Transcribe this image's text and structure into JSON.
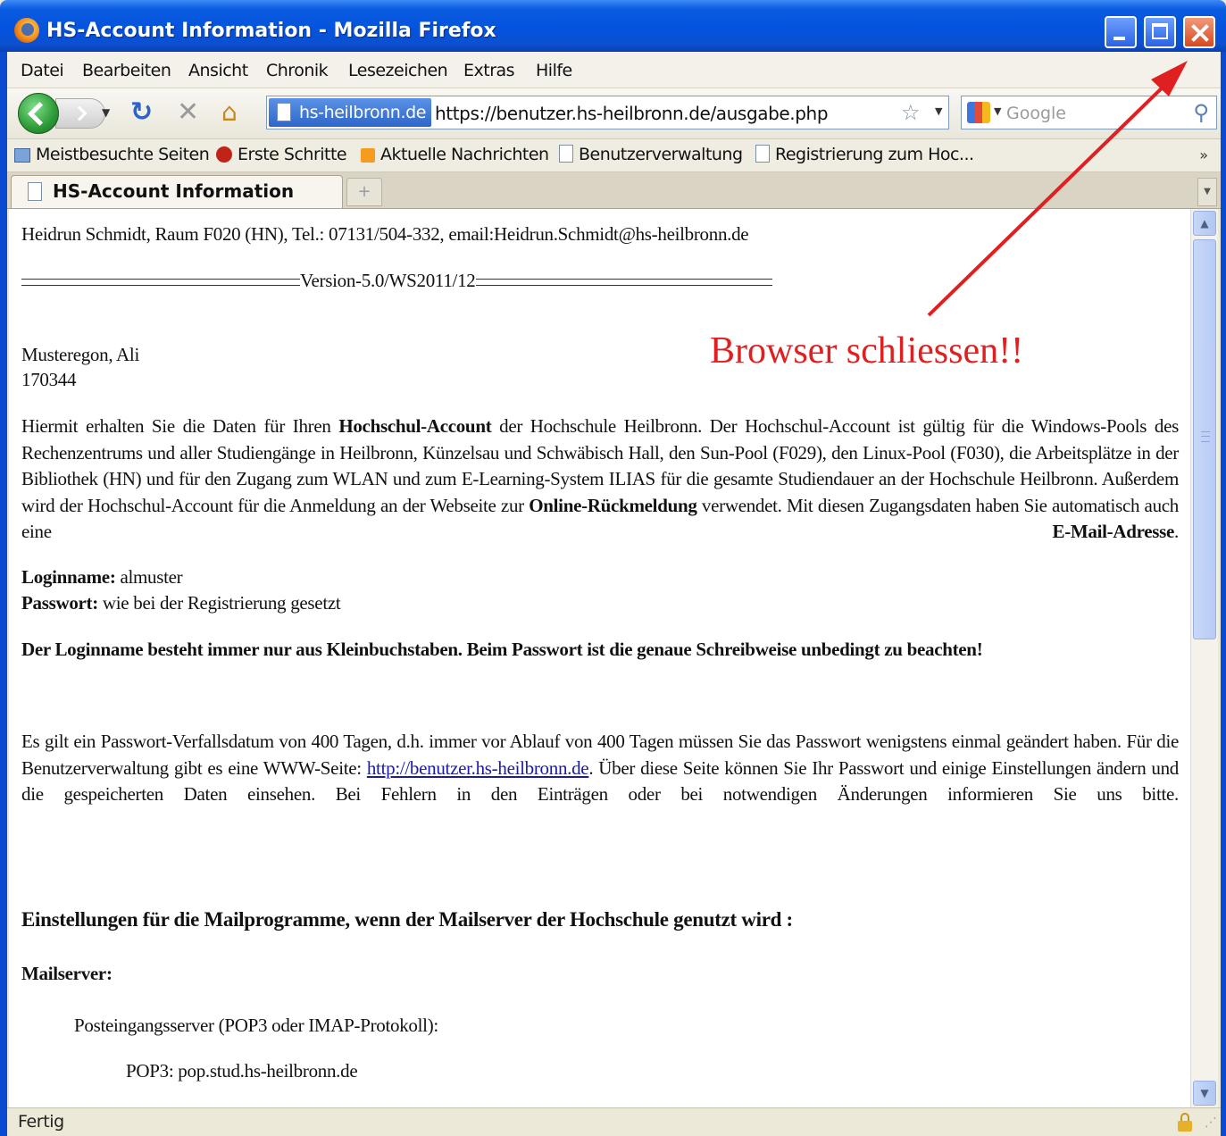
{
  "window": {
    "title": "HS-Account Information - Mozilla Firefox"
  },
  "menu": [
    "Datei",
    "Bearbeiten",
    "Ansicht",
    "Chronik",
    "Lesezeichen",
    "Extras",
    "Hilfe"
  ],
  "navbar": {
    "site_identity": "hs-heilbronn.de",
    "url": "https://benutzer.hs-heilbronn.de/ausgabe.php",
    "search_placeholder": "Google"
  },
  "bookmarks": [
    {
      "label": "Meistbesuchte Seiten",
      "icon": "folder-icon"
    },
    {
      "label": "Erste Schritte",
      "icon": "firefox-bug-icon"
    },
    {
      "label": "Aktuelle Nachrichten",
      "icon": "rss-icon"
    },
    {
      "label": "Benutzerverwaltung",
      "icon": "page-icon"
    },
    {
      "label": "Registrierung zum Hoc...",
      "icon": "page-icon"
    }
  ],
  "tabs": [
    {
      "label": "HS-Account Information"
    }
  ],
  "content": {
    "contact": "Heidrun Schmidt, Raum F020 (HN), Tel.: 07131/504-332, email:Heidrun.Schmidt@hs-heilbronn.de",
    "version": "Version-5.0/WS2011/12",
    "name": "Musteregon, Ali",
    "id": "170344",
    "intro": {
      "t1": "Hiermit erhalten Sie die Daten für Ihren ",
      "b1": "Hochschul-Account",
      "t2": " der Hochschule Heilbronn. Der Hochschul-Account ist gültig für die Windows-Pools des Rechenzentrums und aller Studiengänge in Heilbronn, Künzelsau und Schwäbisch Hall, den Sun-Pool (F029), den Linux-Pool (F030), die Arbeitsplätze in der Bibliothek (HN) und für den Zugang zum WLAN und zum E-Learning-System ILIAS für die gesamte Studiendauer an der Hochschule Heilbronn. Außerdem wird der Hochschul-Account für die Anmeldung an der Webseite zur ",
      "b2": "Online-Rückmeldung",
      "t3": " verwendet. Mit diesen Zugangsdaten haben Sie automatisch auch eine ",
      "b3": "E-Mail-Adresse",
      "t4": "."
    },
    "login_label": "Loginname:",
    "login_value": " almuster",
    "password_label": "Passwort:",
    "password_value": " wie bei der Registrierung gesetzt",
    "warning": "Der Loginname besteht immer nur aus Kleinbuchstaben. Beim Passwort ist die genaue Schreibweise unbedingt zu beachten!",
    "expiry": {
      "t1": "Es gilt ein Passwort-Verfallsdatum von 400 Tagen, d.h. immer vor Ablauf von 400 Tagen müssen Sie das Passwort wenigstens einmal geändert haben. Für die Benutzerverwaltung gibt es eine WWW-Seite: ",
      "link": "http://benutzer.hs-heilbronn.de",
      "t2": ". Über diese Seite können Sie Ihr Passwort und einige Einstellungen ändern und die gespeicherten Daten einsehen. Bei Fehlern in den Einträgen oder bei notwendigen Änderungen informieren Sie uns bitte."
    },
    "mail_heading": "Einstellungen für die Mailprogramme, wenn der Mailserver der Hochschule genutzt wird :",
    "mailserver_label": "Mailserver:",
    "incoming_label": "Posteingangsserver (POP3 oder IMAP-Protokoll):",
    "pop3": "POP3: pop.stud.hs-heilbronn.de"
  },
  "status": "Fertig",
  "annotation": {
    "text": "Browser schliessen!!",
    "color": "#e02020"
  },
  "colors": {
    "titlebar": "#0553de",
    "link": "#1a1aa6"
  }
}
